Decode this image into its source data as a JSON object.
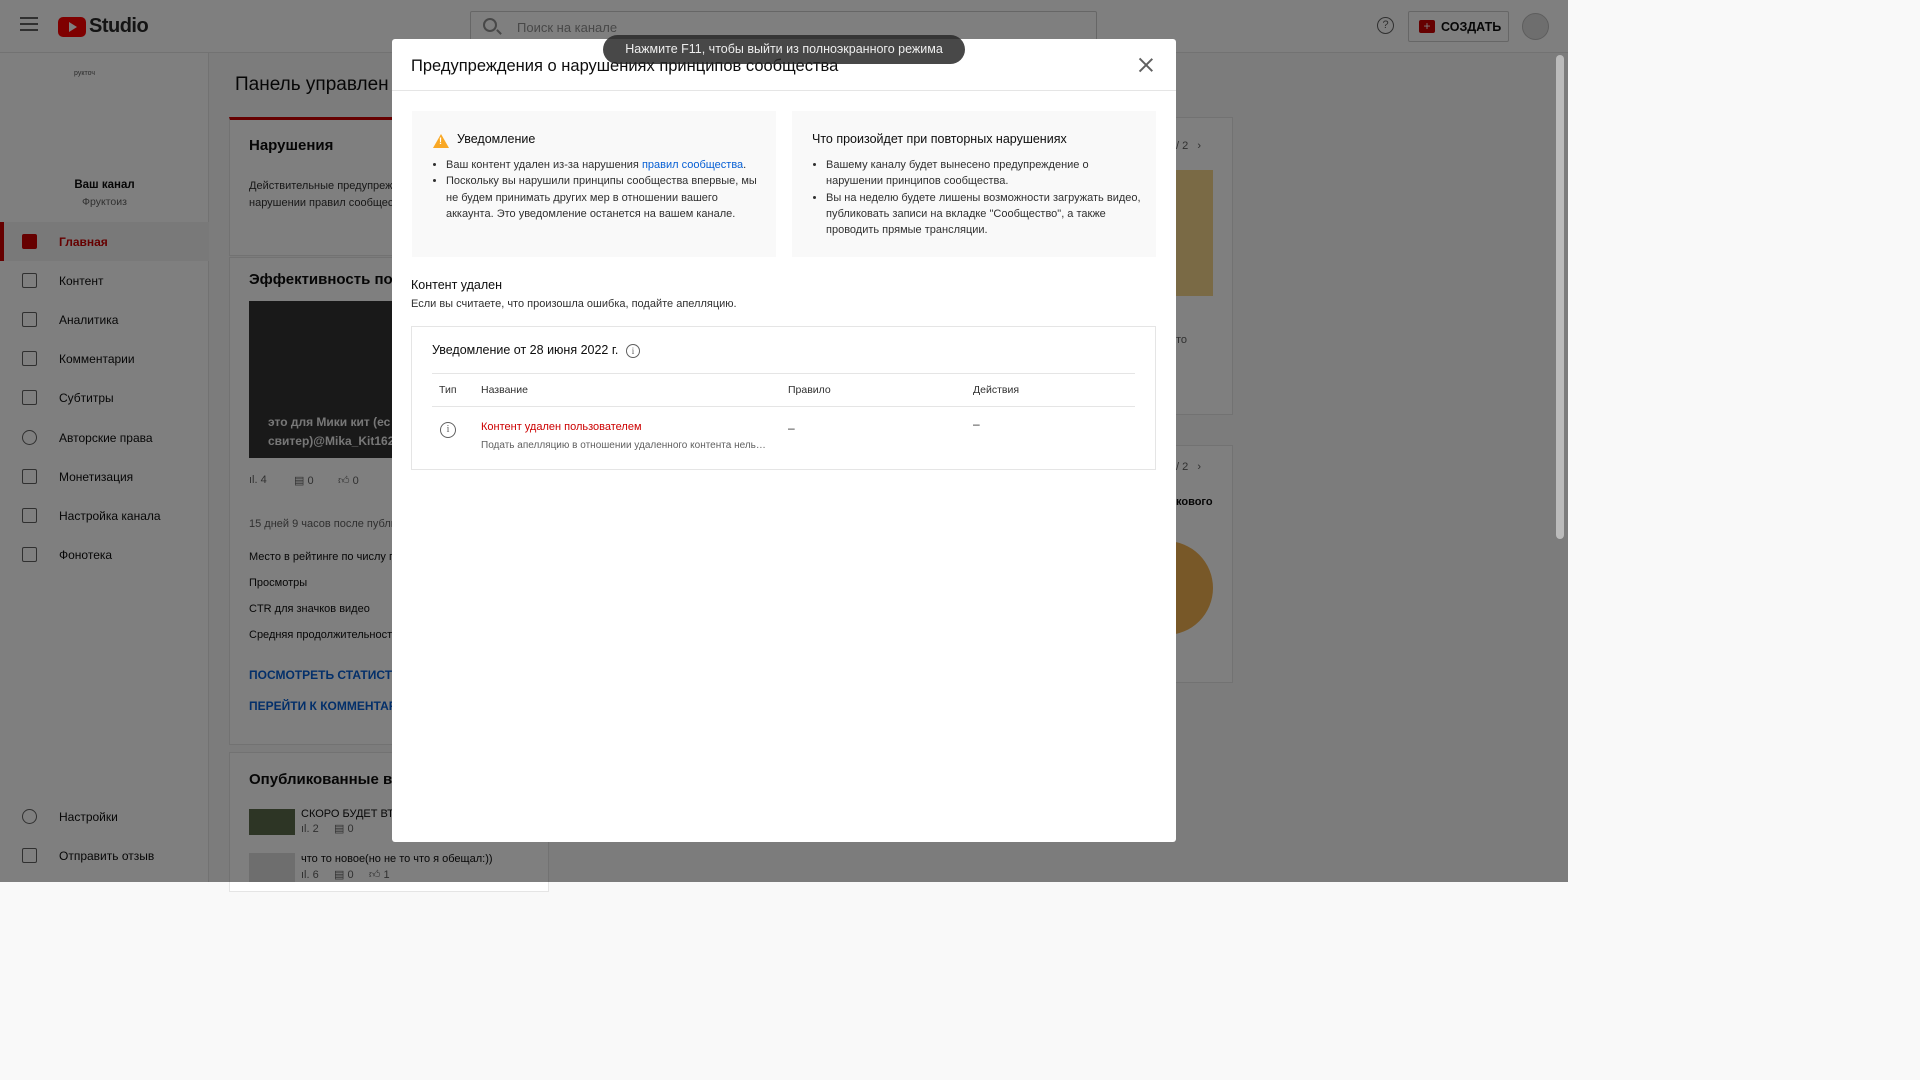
{
  "header": {
    "brand": "Studio",
    "search_placeholder": "Поиск на канале",
    "create_label": "СОЗДАТЬ"
  },
  "sidebar": {
    "channel_logo_text": "рукточ",
    "channel_title": "Ваш канал",
    "channel_name": "Фруктоиз",
    "items": [
      {
        "label": "Главная",
        "icon": "dashboard-icon"
      },
      {
        "label": "Контент",
        "icon": "content-icon"
      },
      {
        "label": "Аналитика",
        "icon": "analytics-icon"
      },
      {
        "label": "Комментарии",
        "icon": "comments-icon"
      },
      {
        "label": "Субтитры",
        "icon": "subtitles-icon"
      },
      {
        "label": "Авторские права",
        "icon": "copyright-icon"
      },
      {
        "label": "Монетизация",
        "icon": "money-icon"
      },
      {
        "label": "Настройка канала",
        "icon": "customize-icon"
      },
      {
        "label": "Фонотека",
        "icon": "audio-library-icon"
      }
    ],
    "bottom": [
      {
        "label": "Настройки",
        "icon": "gear-icon"
      },
      {
        "label": "Отправить отзыв",
        "icon": "feedback-icon"
      }
    ]
  },
  "main": {
    "title": "Панель управлен",
    "violations": {
      "title": "Нарушения",
      "text1": "Действительные предупреж",
      "text2": "нарушении правил сообщест"
    },
    "performance": {
      "title": "Эффективность посл",
      "thumb_line1": "это для Мики кит (ес",
      "thumb_line2": "свитер)@Mika_Kit162",
      "views": "4",
      "comments": "0",
      "likes": "0",
      "since": "15 дней 9 часов после публи",
      "rows": [
        "Место в рейтинге по числу п",
        "Просмотры",
        "CTR для значков видео",
        "Средняя продолжительност"
      ],
      "link1": "ПОСМОТРЕТЬ СТАТИСТИН",
      "link2": "ПЕРЕЙТИ К КОММЕНТАРИ"
    },
    "published": {
      "title": "Опубликованные вид",
      "videos": [
        {
          "title": "СКОРО БУДЕТ ВТО",
          "views": "2",
          "comments": "0"
        },
        {
          "title": "что то новое(но не то что я обещал:))",
          "views": "6",
          "comments": "0",
          "likes": "1"
        }
      ]
    },
    "right_snips": {
      "pager1": "2",
      "snip_text": "то",
      "pager2": "2",
      "snip_text2": "кового"
    }
  },
  "toast": "Нажмите F11, чтобы выйти из полноэкранного режима",
  "dialog": {
    "title": "Предупреждения о нарушениях принципов сообщества",
    "notice": {
      "title": "Уведомление",
      "b1_pre": "Ваш контент удален из-за нарушения ",
      "b1_link": "правил сообщества",
      "b1_post": ".",
      "b2": "Поскольку вы нарушили принципы сообщества впервые, мы не будем принимать других мер в отношении вашего аккаунта. Это уведомление останется на вашем канале."
    },
    "repeat": {
      "title": "Что произойдет при повторных нарушениях",
      "b1": "Вашему каналу будет вынесено предупреждение о нарушении принципов сообщества.",
      "b2": "Вы на неделю будете лишены возможности загружать видео, публиковать записи на вкладке \"Сообщество\", а также проводить прямые трансляции."
    },
    "removed_title": "Контент удален",
    "removed_sub": "Если вы считаете, что произошла ошибка, подайте апелляцию.",
    "table": {
      "heading": "Уведомление от 28 июня 2022 г.",
      "columns": [
        "Тип",
        "Название",
        "Правило",
        "Действия"
      ],
      "row": {
        "name": "Контент удален пользователем",
        "note": "Подать апелляцию в отношении удаленного контента нель…",
        "rule": "–",
        "action": "–"
      }
    }
  },
  "colors": {
    "accent": "#cc0000",
    "link": "#065fd4"
  }
}
